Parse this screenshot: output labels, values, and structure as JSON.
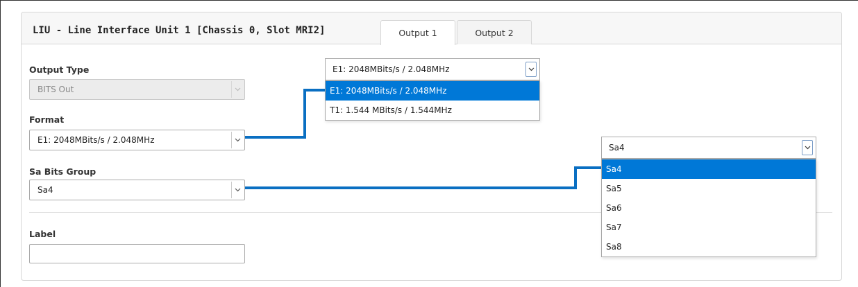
{
  "panel": {
    "title": "LIU - Line Interface Unit 1 [Chassis 0, Slot MRI2]",
    "tabs": [
      {
        "label": "Output 1",
        "active": true
      },
      {
        "label": "Output 2",
        "active": false
      }
    ]
  },
  "form": {
    "output_type": {
      "label": "Output Type",
      "value": "BITS Out",
      "disabled": true
    },
    "format": {
      "label": "Format",
      "value": "E1: 2048MBits/s / 2.048MHz"
    },
    "sa_bits_group": {
      "label": "Sa Bits Group",
      "value": "Sa4"
    },
    "label_field": {
      "label": "Label",
      "value": ""
    }
  },
  "format_dropdown": {
    "selected": "E1: 2048MBits/s / 2.048MHz",
    "options": [
      "E1: 2048MBits/s / 2.048MHz",
      "T1: 1.544 MBits/s / 1.544MHz"
    ],
    "highlighted_index": 0
  },
  "sa_dropdown": {
    "selected": "Sa4",
    "options": [
      "Sa4",
      "Sa5",
      "Sa6",
      "Sa7",
      "Sa8"
    ],
    "highlighted_index": 0
  },
  "colors": {
    "highlight": "#0078d7",
    "connector": "#0a6fc2"
  }
}
